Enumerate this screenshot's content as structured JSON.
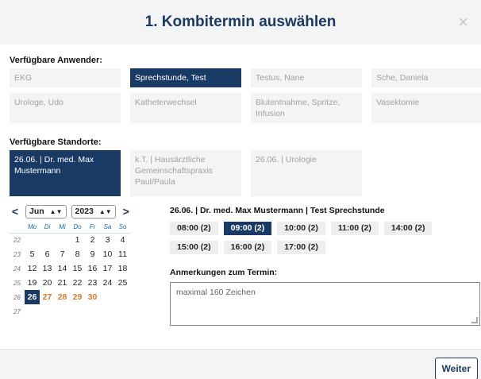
{
  "modal": {
    "title": "1. Kombitermin auswählen",
    "close_label": "×"
  },
  "anwender": {
    "label": "Verfügbare Anwender:",
    "items": [
      {
        "label": "EKG",
        "selected": false
      },
      {
        "label": "Sprechstunde, Test",
        "selected": true
      },
      {
        "label": "Testus, Nane",
        "selected": false
      },
      {
        "label": "Sche, Daniela",
        "selected": false
      },
      {
        "label": "Urologe, Udo",
        "selected": false
      },
      {
        "label": "Katheterwechsel",
        "selected": false
      },
      {
        "label": "Blutentnahme, Spritze, Infusion",
        "selected": false
      },
      {
        "label": "Vasektomie",
        "selected": false
      }
    ]
  },
  "standorte": {
    "label": "Verfügbare Standorte:",
    "items": [
      {
        "label": "26.06. | Dr. med. Max Mustermann",
        "selected": true
      },
      {
        "label": "k.T. | Hausärztliche Gemeinschaftspraxis Paul/Paula",
        "selected": false
      },
      {
        "label": "26.06. | Urologie",
        "selected": false
      }
    ]
  },
  "calendar": {
    "prev": "<",
    "next": ">",
    "month": "Jun",
    "year": "2023",
    "weekdays": [
      "Mo",
      "Di",
      "Mi",
      "Do",
      "Fr",
      "Sa",
      "So"
    ],
    "weeks": [
      {
        "wk": "22",
        "days": [
          "",
          "",
          "",
          "1",
          "2",
          "3",
          "4"
        ]
      },
      {
        "wk": "23",
        "days": [
          "5",
          "6",
          "7",
          "8",
          "9",
          "10",
          "11"
        ]
      },
      {
        "wk": "24",
        "days": [
          "12",
          "13",
          "14",
          "15",
          "16",
          "17",
          "18"
        ]
      },
      {
        "wk": "25",
        "days": [
          "19",
          "20",
          "21",
          "22",
          "23",
          "24",
          "25"
        ]
      },
      {
        "wk": "26",
        "days": [
          "26",
          "27",
          "28",
          "29",
          "30",
          "",
          ""
        ]
      },
      {
        "wk": "27",
        "days": [
          "",
          "",
          "",
          "",
          "",
          "",
          ""
        ]
      }
    ],
    "selected_day": "26",
    "highlight_days": [
      "27",
      "28",
      "29",
      "30"
    ]
  },
  "slots": {
    "title": "26.06. | Dr. med. Max Mustermann | Test Sprechstunde",
    "items": [
      {
        "label": "08:00 (2)",
        "selected": false
      },
      {
        "label": "09:00 (2)",
        "selected": true
      },
      {
        "label": "10:00 (2)",
        "selected": false
      },
      {
        "label": "11:00 (2)",
        "selected": false
      },
      {
        "label": "14:00 (2)",
        "selected": false
      },
      {
        "label": "15:00 (2)",
        "selected": false
      },
      {
        "label": "16:00 (2)",
        "selected": false
      },
      {
        "label": "17:00 (2)",
        "selected": false
      }
    ]
  },
  "notes": {
    "label": "Anmerkungen zum Termin:",
    "placeholder": "maximal 160 Zeichen"
  },
  "footer": {
    "next_label": "Weiter"
  },
  "colors": {
    "primary": "#1a3a66",
    "highlight": "#e07a2c",
    "panel": "#f4f4f4"
  }
}
